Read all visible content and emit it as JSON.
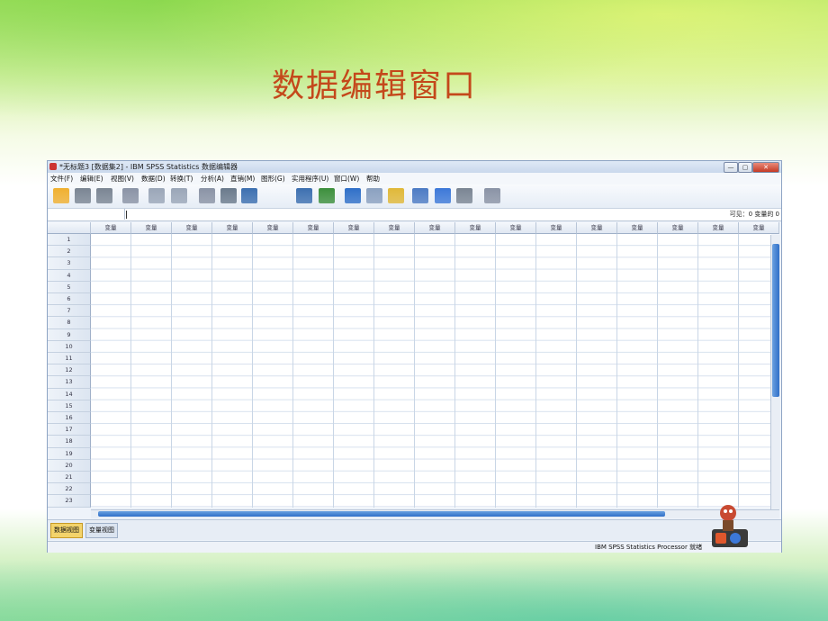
{
  "slide": {
    "title": "数据编辑窗口"
  },
  "window": {
    "title": "*无标题3 [数据集2] - IBM SPSS Statistics 数据编辑器",
    "controls": [
      "—",
      "▢",
      "✕"
    ]
  },
  "menu": [
    "文件(F)",
    "编辑(E)",
    "视图(V)",
    "数据(D)",
    "转换(T)",
    "分析(A)",
    "直销(M)",
    "图形(G)",
    "实用程序(U)",
    "窗口(W)",
    "帮助"
  ],
  "toolbar_icons": [
    "open-folder-icon",
    "save-icon",
    "print-icon",
    "dialog-recall-icon",
    "undo-icon",
    "redo-icon",
    "goto-case-icon",
    "goto-variable-icon",
    "variables-icon",
    "find-icon",
    "insert-cases-icon",
    "insert-variable-icon",
    "split-file-icon",
    "weight-cases-icon",
    "select-cases-icon",
    "value-labels-icon",
    "use-sets-icon",
    "show-all-variables-icon",
    "spell-check-icon"
  ],
  "formula_bar": {
    "visible_text": "可见：0 变量的 0"
  },
  "grid": {
    "column_header": "变量",
    "column_count": 17,
    "rows": [
      "1",
      "2",
      "3",
      "4",
      "5",
      "6",
      "7",
      "8",
      "9",
      "10",
      "11",
      "12",
      "13",
      "14",
      "15",
      "16",
      "17",
      "18",
      "19",
      "20",
      "21",
      "22",
      "23"
    ]
  },
  "tabs": [
    {
      "label": "数据视图",
      "active": true
    },
    {
      "label": "变量视图",
      "active": false
    }
  ],
  "status": {
    "text": "IBM SPSS Statistics Processor 就绪"
  },
  "colors": {
    "title_color": "#c4481b",
    "accent_blue": "#2f6fc8",
    "active_tab": "#f3d36b"
  }
}
